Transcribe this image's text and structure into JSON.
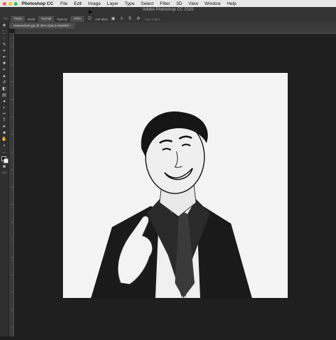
{
  "menubar": {
    "app_name": "Photoshop CC",
    "items": [
      "File",
      "Edit",
      "Image",
      "Layer",
      "Type",
      "Select",
      "Filter",
      "3D",
      "View",
      "Window",
      "Help"
    ]
  },
  "window": {
    "title": "Adobe Photoshop CC 2015"
  },
  "options": {
    "source": "Pixels",
    "mode_label": "Mode:",
    "mode_value": "Normal",
    "opacity_label": "Opacity:",
    "opacity_value": "100%",
    "antialias_label": "Anti-alias",
    "align_edges_label": "Align Edges"
  },
  "document": {
    "tab_title": "Hakanebark.jpg @ 50% (Quick Mask/8) *"
  },
  "colors": {
    "menubar_bg": "#e7e7e7",
    "panel_bg": "#333333",
    "canvas_bg": "#1f1f1f",
    "close": "#fc5f57",
    "min": "#fdbc2e",
    "max": "#28c840"
  },
  "tools": [
    "move-icon",
    "marquee-icon",
    "lasso-icon",
    "quick-select-icon",
    "crop-icon",
    "eyedropper-icon",
    "healing-icon",
    "brush-icon",
    "stamp-icon",
    "history-brush-icon",
    "eraser-icon",
    "gradient-icon",
    "blur-icon",
    "dodge-icon",
    "pen-icon",
    "type-icon",
    "path-select-icon",
    "shape-icon",
    "hand-icon",
    "zoom-icon",
    "more-icon",
    "color-swatch-icon",
    "quick-mask-icon",
    "screen-mode-icon"
  ]
}
